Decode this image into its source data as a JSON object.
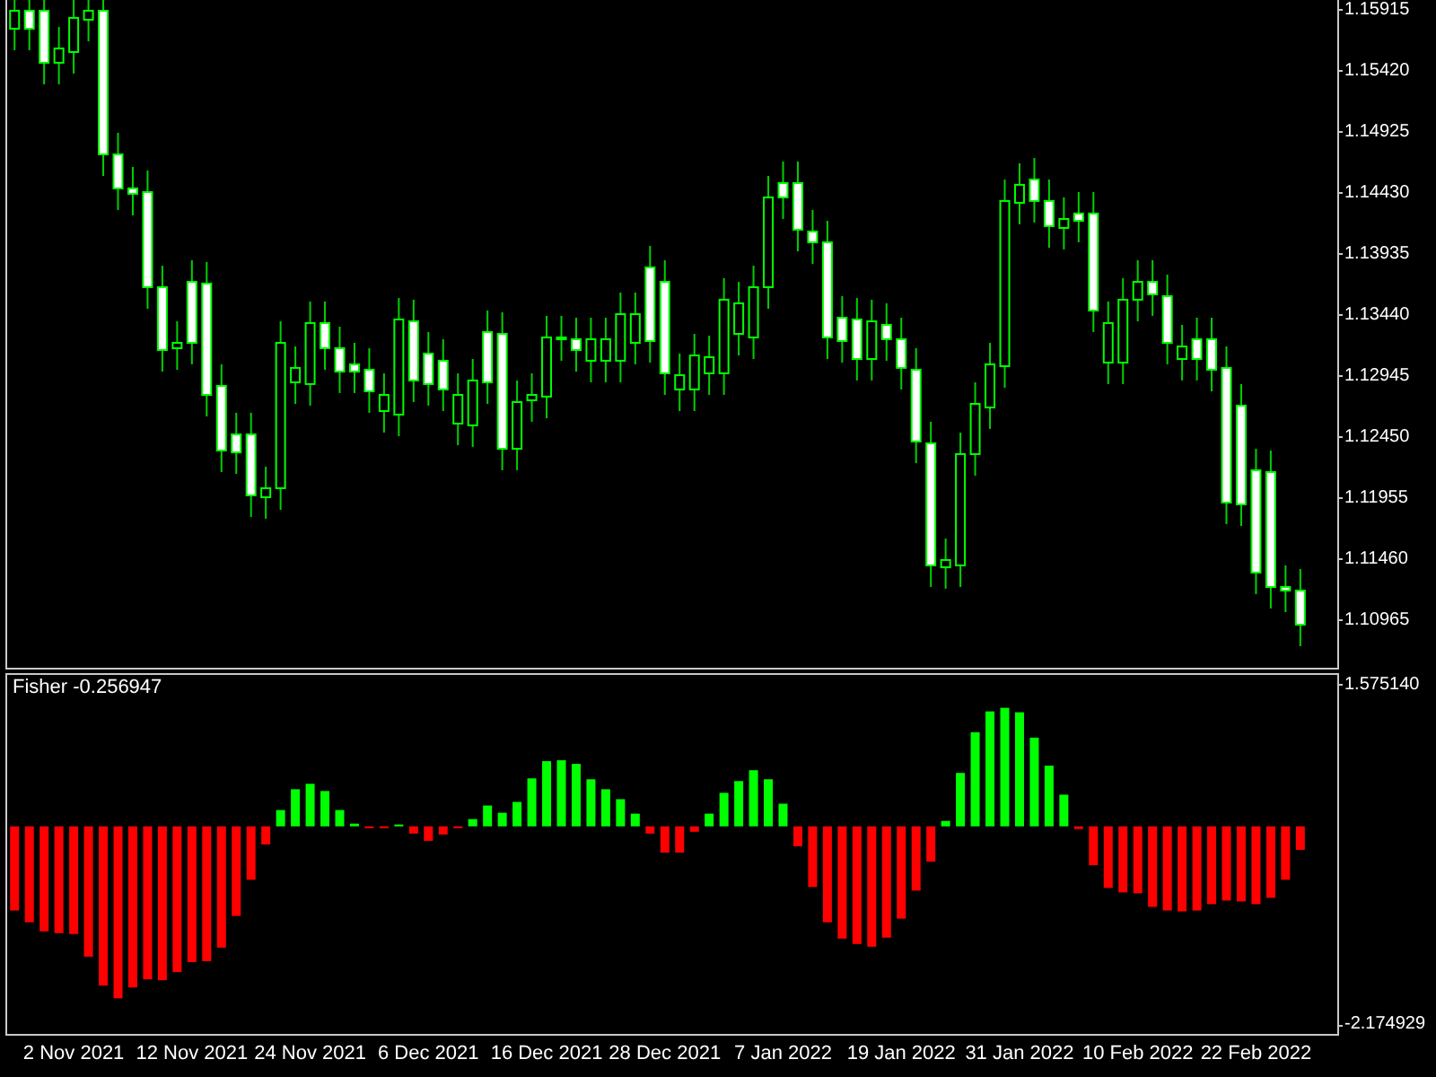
{
  "price_panel": {
    "chart_data": {
      "type": "candlestick",
      "categories": [
        null,
        null,
        null,
        null,
        null,
        null,
        null,
        null,
        null,
        null,
        null,
        null,
        null,
        null,
        null,
        null,
        null,
        null,
        null,
        null,
        null,
        null,
        null,
        null,
        null,
        null,
        null,
        null,
        null,
        null,
        null,
        null,
        null,
        null,
        null,
        null,
        null,
        null,
        null,
        null,
        null,
        null,
        null,
        null,
        null,
        null,
        null,
        null,
        null,
        null,
        null,
        null,
        null,
        null,
        null,
        null,
        null,
        null,
        null,
        null,
        null,
        null,
        null,
        null,
        null,
        null,
        null,
        null,
        null,
        null,
        null,
        null,
        null,
        null,
        null,
        null,
        null,
        null,
        null,
        null,
        null,
        null,
        null,
        null,
        null,
        null,
        null,
        null,
        null,
        null
      ],
      "ylim": [
        1.10586,
        1.16002
      ],
      "yticks": [
        {
          "value": 1.15915,
          "label": "1.15915"
        },
        {
          "value": 1.1542,
          "label": "1.15420"
        },
        {
          "value": 1.14925,
          "label": "1.14925"
        },
        {
          "value": 1.1443,
          "label": "1.14430"
        },
        {
          "value": 1.13935,
          "label": "1.13935"
        },
        {
          "value": 1.1344,
          "label": "1.13440"
        },
        {
          "value": 1.12945,
          "label": "1.12945"
        },
        {
          "value": 1.1245,
          "label": "1.12450"
        },
        {
          "value": 1.11955,
          "label": "1.11955"
        },
        {
          "value": 1.1146,
          "label": "1.11460"
        },
        {
          "value": 1.10965,
          "label": "1.10965"
        }
      ],
      "ohlc": [
        [
          1.15769,
          1.1609,
          1.15595,
          1.15915
        ],
        [
          1.15915,
          1.1609,
          1.15595,
          1.15769
        ],
        [
          1.15915,
          1.1609,
          1.15318,
          1.15493
        ],
        [
          1.15493,
          1.15784,
          1.15318,
          1.15609
        ],
        [
          1.1558,
          1.16031,
          1.15405,
          1.15857
        ],
        [
          1.15842,
          1.1609,
          1.15667,
          1.15915
        ],
        [
          1.15915,
          1.1609,
          1.14575,
          1.1475
        ],
        [
          1.1475,
          1.14925,
          1.14299,
          1.14474
        ],
        [
          1.14474,
          1.14648,
          1.14255,
          1.1443
        ],
        [
          1.14444,
          1.14619,
          1.13498,
          1.13673
        ],
        [
          1.13673,
          1.13847,
          1.12988,
          1.13163
        ],
        [
          1.13178,
          1.13396,
          1.13003,
          1.13221
        ],
        [
          1.13716,
          1.13891,
          1.13047,
          1.13221
        ],
        [
          1.13702,
          1.13877,
          1.12624,
          1.12799
        ],
        [
          1.12872,
          1.13047,
          1.12173,
          1.12348
        ],
        [
          1.12479,
          1.12654,
          1.12159,
          1.12333
        ],
        [
          1.12479,
          1.12654,
          1.11809,
          1.11984
        ],
        [
          1.11969,
          1.12217,
          1.11795,
          1.12042
        ],
        [
          1.12042,
          1.13396,
          1.11867,
          1.13221
        ],
        [
          1.12901,
          1.13192,
          1.12726,
          1.13018
        ],
        [
          1.12887,
          1.13556,
          1.12712,
          1.13382
        ],
        [
          1.13382,
          1.13556,
          1.13003,
          1.13178
        ],
        [
          1.13178,
          1.13352,
          1.12814,
          1.12988
        ],
        [
          1.13047,
          1.13221,
          1.12814,
          1.12988
        ],
        [
          1.13003,
          1.13178,
          1.12654,
          1.12828
        ],
        [
          1.12668,
          1.12974,
          1.12493,
          1.12799
        ],
        [
          1.12639,
          1.13585,
          1.12464,
          1.13411
        ],
        [
          1.13396,
          1.13571,
          1.12741,
          1.12916
        ],
        [
          1.13134,
          1.13309,
          1.12712,
          1.12887
        ],
        [
          1.13076,
          1.13251,
          1.12668,
          1.12843
        ],
        [
          1.12566,
          1.12974,
          1.12391,
          1.12799
        ],
        [
          1.12552,
          1.1309,
          1.12377,
          1.12916
        ],
        [
          1.13309,
          1.13483,
          1.12726,
          1.12901
        ],
        [
          1.13294,
          1.13469,
          1.12188,
          1.12362
        ],
        [
          1.12362,
          1.12916,
          1.12188,
          1.12741
        ],
        [
          1.12755,
          1.12974,
          1.12581,
          1.12799
        ],
        [
          1.12785,
          1.1344,
          1.1261,
          1.13265
        ],
        [
          1.13265,
          1.1344,
          1.13076,
          1.13251
        ],
        [
          1.13251,
          1.13425,
          1.12988,
          1.13163
        ],
        [
          1.13076,
          1.13425,
          1.12901,
          1.13251
        ],
        [
          1.13076,
          1.13425,
          1.12901,
          1.13251
        ],
        [
          1.13076,
          1.13629,
          1.12901,
          1.13454
        ],
        [
          1.13221,
          1.13629,
          1.13047,
          1.13454
        ],
        [
          1.13833,
          1.14008,
          1.13061,
          1.13236
        ],
        [
          1.13716,
          1.13891,
          1.12799,
          1.12974
        ],
        [
          1.12843,
          1.13134,
          1.12668,
          1.12959
        ],
        [
          1.12843,
          1.13294,
          1.12668,
          1.13119
        ],
        [
          1.12974,
          1.1328,
          1.12799,
          1.13105
        ],
        [
          1.12974,
          1.13746,
          1.12799,
          1.13571
        ],
        [
          1.13294,
          1.13716,
          1.13119,
          1.13542
        ],
        [
          1.13265,
          1.13847,
          1.1309,
          1.13673
        ],
        [
          1.13673,
          1.14575,
          1.13498,
          1.14401
        ],
        [
          1.14517,
          1.14692,
          1.14226,
          1.14401
        ],
        [
          1.14517,
          1.14692,
          1.13964,
          1.14139
        ],
        [
          1.14124,
          1.14299,
          1.13862,
          1.14037
        ],
        [
          1.14037,
          1.14211,
          1.1309,
          1.13265
        ],
        [
          1.13425,
          1.136,
          1.13061,
          1.13236
        ],
        [
          1.13411,
          1.13585,
          1.12916,
          1.1309
        ],
        [
          1.1309,
          1.13571,
          1.12916,
          1.13396
        ],
        [
          1.13367,
          1.13542,
          1.13076,
          1.13251
        ],
        [
          1.13251,
          1.13425,
          1.12843,
          1.13018
        ],
        [
          1.13003,
          1.13178,
          1.12246,
          1.12421
        ],
        [
          1.12406,
          1.12581,
          1.11241,
          1.11416
        ],
        [
          1.11401,
          1.11634,
          1.11227,
          1.1146
        ],
        [
          1.11416,
          1.12493,
          1.11241,
          1.12319
        ],
        [
          1.12319,
          1.12901,
          1.12144,
          1.12726
        ],
        [
          1.12697,
          1.13221,
          1.12523,
          1.13047
        ],
        [
          1.13032,
          1.14546,
          1.12857,
          1.14372
        ],
        [
          1.14357,
          1.14677,
          1.14182,
          1.14503
        ],
        [
          1.14546,
          1.14721,
          1.14197,
          1.14372
        ],
        [
          1.14372,
          1.14546,
          1.13993,
          1.14168
        ],
        [
          1.14153,
          1.14401,
          1.13979,
          1.14226
        ],
        [
          1.1427,
          1.14444,
          1.14037,
          1.14211
        ],
        [
          1.1427,
          1.14444,
          1.13309,
          1.13483
        ],
        [
          1.13061,
          1.13556,
          1.12887,
          1.13382
        ],
        [
          1.13061,
          1.13746,
          1.12887,
          1.13571
        ],
        [
          1.13571,
          1.13891,
          1.13396,
          1.13716
        ],
        [
          1.13716,
          1.13891,
          1.1344,
          1.13615
        ],
        [
          1.136,
          1.13775,
          1.13047,
          1.13221
        ],
        [
          1.1309,
          1.13367,
          1.12916,
          1.13192
        ],
        [
          1.13251,
          1.13425,
          1.12916,
          1.1309
        ],
        [
          1.13251,
          1.13425,
          1.12828,
          1.13003
        ],
        [
          1.13018,
          1.13192,
          1.11751,
          1.11926
        ],
        [
          1.12712,
          1.12887,
          1.11736,
          1.11911
        ],
        [
          1.12188,
          1.12362,
          1.11183,
          1.11358
        ],
        [
          1.12173,
          1.12348,
          1.11067,
          1.11241
        ],
        [
          1.11241,
          1.11416,
          1.11037,
          1.11212
        ],
        [
          1.11212,
          1.11387,
          1.10761,
          1.10935
        ],
        null,
        null
      ]
    }
  },
  "indicator_panel": {
    "label": "Fisher -0.256947",
    "chart_data": {
      "type": "bar",
      "categories": [
        null,
        null,
        null,
        null,
        "2 Nov 2021",
        null,
        null,
        null,
        null,
        null,
        null,
        null,
        "12 Nov 2021",
        null,
        null,
        null,
        null,
        null,
        null,
        null,
        "24 Nov 2021",
        null,
        null,
        null,
        null,
        null,
        null,
        null,
        "6 Dec 2021",
        null,
        null,
        null,
        null,
        null,
        null,
        null,
        "16 Dec 2021",
        null,
        null,
        null,
        null,
        null,
        null,
        null,
        "28 Dec 2021",
        null,
        null,
        null,
        null,
        null,
        null,
        null,
        "7 Jan 2022",
        null,
        null,
        null,
        null,
        null,
        null,
        null,
        "19 Jan 2022",
        null,
        null,
        null,
        null,
        null,
        null,
        null,
        "31 Jan 2022",
        null,
        null,
        null,
        null,
        null,
        null,
        null,
        "10 Feb 2022",
        null,
        null,
        null,
        null,
        null,
        null,
        null,
        "22 Feb 2022",
        null,
        null,
        null,
        null,
        null
      ],
      "ylim": [
        -2.2935,
        1.673
      ],
      "yticks": [
        {
          "value": 1.57514,
          "label": "1.575140"
        },
        {
          "value": -2.174929,
          "label": "-2.174929"
        }
      ],
      "series": [
        {
          "color": "#00ff00",
          "values": [
            null,
            null,
            null,
            null,
            null,
            null,
            null,
            null,
            null,
            null,
            null,
            null,
            null,
            null,
            null,
            null,
            null,
            null,
            0.18,
            0.41,
            0.47,
            0.39,
            0.18,
            0.03,
            null,
            null,
            0.02,
            null,
            null,
            null,
            null,
            0.08,
            0.23,
            0.15,
            0.27,
            0.53,
            0.72,
            0.73,
            0.69,
            0.52,
            0.41,
            0.3,
            0.14,
            null,
            null,
            null,
            null,
            0.14,
            0.37,
            0.5,
            0.62,
            0.52,
            0.25,
            null,
            null,
            null,
            null,
            null,
            null,
            null,
            null,
            null,
            null,
            0.06,
            0.59,
            1.04,
            1.27,
            1.31,
            1.26,
            0.98,
            0.67,
            0.35,
            null,
            null,
            null,
            null,
            null,
            null,
            null,
            null,
            null,
            null,
            null,
            null,
            null,
            null,
            null,
            null,
            null,
            null
          ]
        },
        {
          "color": "#ff0000",
          "values": [
            -0.93,
            -1.06,
            -1.16,
            -1.18,
            -1.19,
            -1.44,
            -1.76,
            -1.9,
            -1.78,
            -1.69,
            -1.7,
            -1.61,
            -1.5,
            -1.49,
            -1.34,
            -0.99,
            -0.59,
            -0.2,
            null,
            null,
            null,
            null,
            null,
            null,
            -0.01,
            -0.01,
            null,
            -0.08,
            -0.16,
            -0.09,
            -0.01,
            null,
            null,
            null,
            null,
            null,
            null,
            null,
            null,
            null,
            null,
            null,
            null,
            -0.08,
            -0.29,
            -0.29,
            -0.06,
            null,
            null,
            null,
            null,
            null,
            null,
            -0.22,
            -0.67,
            -1.06,
            -1.24,
            -1.3,
            -1.33,
            -1.23,
            -1.02,
            -0.71,
            -0.39,
            null,
            null,
            null,
            null,
            null,
            null,
            null,
            null,
            null,
            -0.03,
            -0.43,
            -0.68,
            -0.73,
            -0.74,
            -0.89,
            -0.93,
            -0.94,
            -0.93,
            -0.86,
            -0.82,
            -0.83,
            -0.86,
            -0.79,
            -0.59,
            -0.26,
            null,
            null
          ]
        }
      ]
    }
  }
}
